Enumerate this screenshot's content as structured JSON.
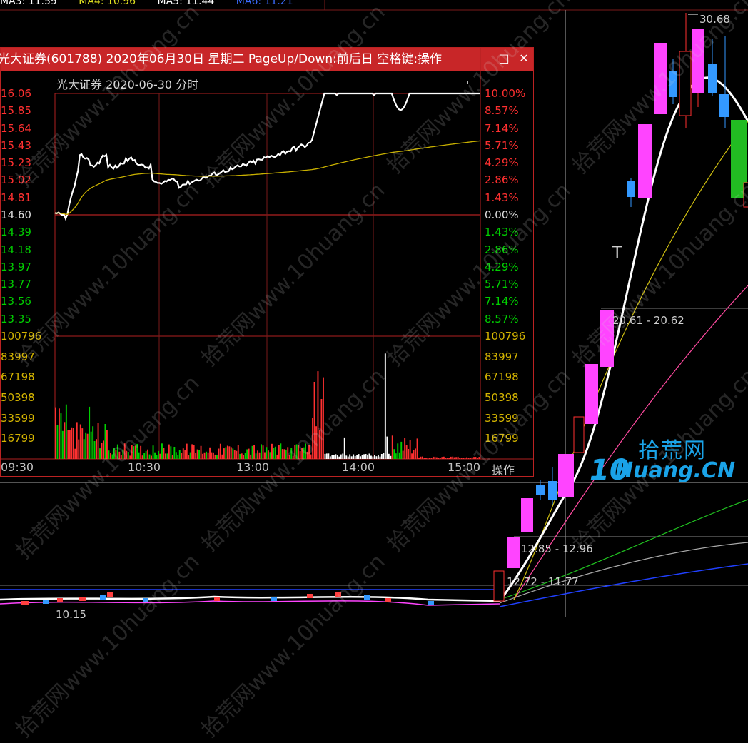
{
  "ma_legend": [
    {
      "text": "MA3: 11.59",
      "color": "#ffffff"
    },
    {
      "text": "MA4: 10.96",
      "color": "#e0e020"
    },
    {
      "text": "MA5: 11.44",
      "color": "#ffffff"
    },
    {
      "text": "MA6: 11.21",
      "color": "#3a6cff"
    }
  ],
  "kline_labels": {
    "high": "30.68",
    "level1": "20.61 - 20.62",
    "level2": "12.85 - 12.96",
    "level3": "12.72 - 11.77",
    "low": "10.15",
    "t_marker": "T"
  },
  "popup": {
    "title": "光大证券(601788) 2020年06月30日 星期二 PageUp/Down:前后日 空格键:操作",
    "subtitle": "光大证券 2020-06-30 分时",
    "operate_label": "操作",
    "price_left": [
      "16.06",
      "15.85",
      "15.64",
      "15.43",
      "15.23",
      "15.02",
      "14.81",
      "14.60",
      "14.39",
      "14.18",
      "13.97",
      "13.77",
      "13.56",
      "13.35"
    ],
    "pct_right": [
      "10.00%",
      "8.57%",
      "7.14%",
      "5.71%",
      "4.29%",
      "2.86%",
      "1.43%",
      "0.00%",
      "1.43%",
      "2.86%",
      "4.29%",
      "5.71%",
      "7.14%",
      "8.57%"
    ],
    "volume_labels": [
      "100796",
      "83997",
      "67198",
      "50398",
      "33599",
      "16799"
    ],
    "time_labels": [
      "09:30",
      "10:30",
      "13:00",
      "14:00",
      "15:00"
    ],
    "prev_close": 14.6
  },
  "colors": {
    "up": "#ff3030",
    "down": "#00d000",
    "neutral": "#ffffff",
    "avg_line": "#c8b000",
    "popup_title_bg": "#c82628",
    "kline_up_fill": "#ff44ff",
    "kline_down_fill": "#22bb22",
    "kline_small_down": "#3399ff"
  },
  "watermark": {
    "text": "拾荒网www.10huang.cn"
  },
  "logo": {
    "top": "拾荒网",
    "ten": "10",
    "bottom": "Huang.CN"
  }
}
